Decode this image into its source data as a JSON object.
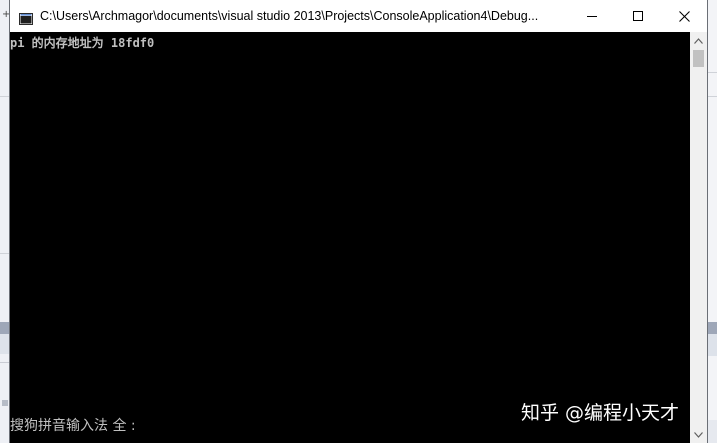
{
  "window": {
    "title": "C:\\Users\\Archmagor\\documents\\visual studio 2013\\Projects\\ConsoleApplication4\\Debug...",
    "icon": "console-app-icon",
    "buttons": {
      "minimize": "minimize-icon",
      "maximize": "maximize-icon",
      "close": "close-icon"
    }
  },
  "console": {
    "output_line": "pi 的内存地址为 18fdf0"
  },
  "ime": {
    "status_text": "搜狗拼音输入法 全 :"
  },
  "watermark": {
    "text": "知乎 @编程小天才"
  },
  "scrollbar": {
    "position_fraction": 0
  },
  "colors": {
    "console_background": "#000000",
    "console_text": "#c0c0c0",
    "titlebar": "#ffffff"
  }
}
